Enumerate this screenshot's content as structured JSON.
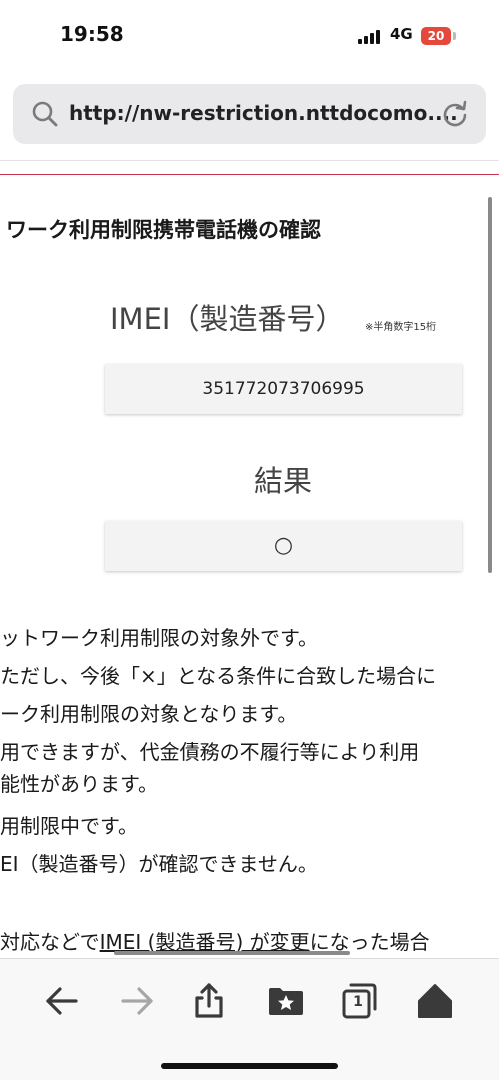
{
  "status_bar": {
    "time": "19:58",
    "network": "4G",
    "battery": "20"
  },
  "browser": {
    "url": "http://nw-restriction.nttdocomo...."
  },
  "page": {
    "title": "ワーク利用制限携帯電話機の確認",
    "imei_heading": "IMEI（製造番号）",
    "imei_note": "※半角数字15桁",
    "imei_value": "351772073706995",
    "result_heading": "結果",
    "result_value": "○"
  },
  "explanation": {
    "line1": "ットワーク利用制限の対象外です。",
    "line2": "ただし、今後「×」となる条件に合致した場合に",
    "line3": "ーク利用制限の対象となります。",
    "line4": "用できますが、代金債務の不履行等により利用",
    "line5": "能性があります。",
    "line6": "用制限中です。",
    "line7": "EI（製造番号）が確認できません。",
    "line8_prefix": "対応などで",
    "line8_link": "IMEI (製造番号) が変更",
    "line8_suffix": "になった場合"
  },
  "toolbar": {
    "tab_count": "1"
  },
  "colors": {
    "accent_red": "#c8344e",
    "battery_red": "#e4493b"
  }
}
